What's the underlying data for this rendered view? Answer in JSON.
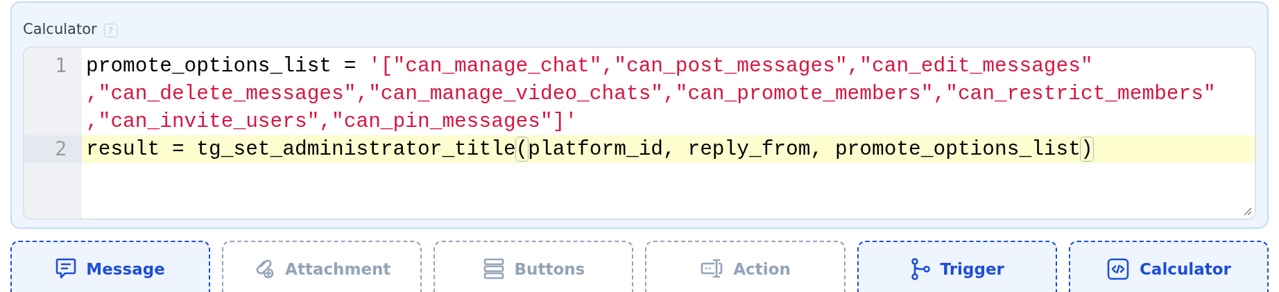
{
  "panel": {
    "title": "Calculator",
    "help": "?"
  },
  "editor": {
    "lines": [
      {
        "number": "1",
        "highlighted": false,
        "rows": [
          [
            {
              "kind": "plain",
              "text": "promote_options_list = "
            },
            {
              "kind": "string",
              "text": "'[\"can_manage_chat\",\"can_post_messages\",\"can_edit_messages\""
            }
          ],
          [
            {
              "kind": "string",
              "text": ",\"can_delete_messages\",\"can_manage_video_chats\",\"can_promote_members\",\"can_restrict_members\""
            }
          ],
          [
            {
              "kind": "string",
              "text": ",\"can_invite_users\",\"can_pin_messages\"]'"
            }
          ]
        ]
      },
      {
        "number": "2",
        "highlighted": true,
        "rows": [
          [
            {
              "kind": "plain",
              "text": "result = tg_set_administrator_title"
            },
            {
              "kind": "matched_bracket",
              "text": "("
            },
            {
              "kind": "plain",
              "text": "platform_id, reply_from, promote_options_list"
            },
            {
              "kind": "matched_bracket",
              "text": ")"
            }
          ]
        ]
      }
    ]
  },
  "blocks": [
    {
      "label": "Message",
      "disabled": false
    },
    {
      "label": "Attachment",
      "disabled": true
    },
    {
      "label": "Buttons",
      "disabled": true
    },
    {
      "label": "Action",
      "disabled": true
    },
    {
      "label": "Trigger",
      "disabled": false
    },
    {
      "label": "Calculator",
      "disabled": false
    }
  ]
}
